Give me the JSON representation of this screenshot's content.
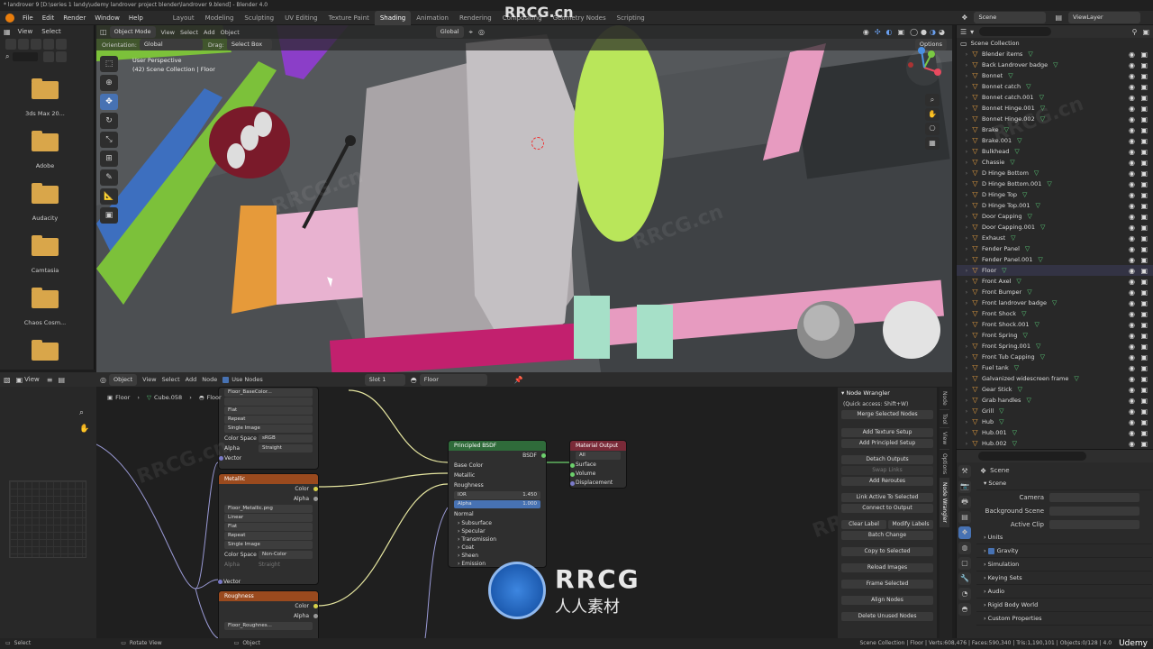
{
  "title": "* landrover 9 [D:\\series 1 landy\\udemy landrover project blender\\landrover 9.blend] - Blender 4.0",
  "menu": [
    "File",
    "Edit",
    "Render",
    "Window",
    "Help"
  ],
  "workspaces": [
    "Layout",
    "Modeling",
    "Sculpting",
    "UV Editing",
    "Texture Paint",
    "Shading",
    "Animation",
    "Rendering",
    "Compositing",
    "Geometry Nodes",
    "Scripting"
  ],
  "active_workspace": "Shading",
  "scene_label": "Scene",
  "view_layer_label": "ViewLayer",
  "watermark_text": "RRCG.cn",
  "filebrowser": {
    "menu": [
      "View",
      "Select"
    ],
    "folders": [
      "3ds Max 20...",
      "Adobe",
      "Audacity",
      "Camtasia",
      "Chaos Cosm..."
    ]
  },
  "viewport": {
    "mode": "Object Mode",
    "menu": [
      "View",
      "Select",
      "Add",
      "Object"
    ],
    "transform": "Global",
    "orientation_label": "Orientation:",
    "orientation_value": "Global",
    "drag_label": "Drag:",
    "drag_value": "Select Box",
    "options": "Options",
    "overlay_line1": "User Perspective",
    "overlay_line2": "(42) Scene Collection | Floor"
  },
  "outliner": {
    "root": "Scene Collection",
    "items": [
      "Blender items",
      "Back Landrover badge",
      "Bonnet",
      "Bonnet catch",
      "Bonnet catch.001",
      "Bonnet Hinge.001",
      "Bonnet Hinge.002",
      "Brake",
      "Brake.001",
      "Bulkhead",
      "Chassie",
      "D Hinge Bottom",
      "D Hinge Bottom.001",
      "D Hinge Top",
      "D Hinge Top.001",
      "Door Capping",
      "Door Capping.001",
      "Exhaust",
      "Fender Panel",
      "Fender Panel.001",
      "Floor",
      "Front Axel",
      "Front Bumper",
      "Front landrover badge",
      "Front Shock",
      "Front Shock.001",
      "Front Spring",
      "Front Spring.001",
      "Front Tub Capping",
      "Fuel tank",
      "Galvanized widescreen frame",
      "Gear Stick",
      "Grab handles",
      "Grill",
      "Hub",
      "Hub.001",
      "Hub.002"
    ]
  },
  "properties": {
    "scene_name": "Scene",
    "section_scene": "Scene",
    "camera_label": "Camera",
    "background_label": "Background Scene",
    "active_clip_label": "Active Clip",
    "sections": [
      "Units",
      "Gravity",
      "Simulation",
      "Keying Sets",
      "Audio",
      "Rigid Body World",
      "Custom Properties"
    ]
  },
  "node_editor": {
    "object_menu": "Object",
    "menu": [
      "View",
      "Select",
      "Add",
      "Node"
    ],
    "use_nodes": "Use Nodes",
    "slot": "Slot 1",
    "material": "Floor",
    "breadcrumb": [
      "Floor",
      "Cube.058",
      "Floor"
    ],
    "base_color_node": {
      "title": "Floor_BaseColor...",
      "interp": "Flat",
      "ext": "Repeat",
      "src": "Single Image",
      "cs_label": "Color Space",
      "cs": "sRGB",
      "alpha_label": "Alpha",
      "alpha": "Straight",
      "vector": "Vector"
    },
    "metallic_node": {
      "title": "Metallic",
      "color": "Color",
      "alpha": "Alpha",
      "file": "Floor_Metallic.png",
      "interp": "Linear",
      "proj": "Flat",
      "ext": "Repeat",
      "src": "Single Image",
      "cs_label": "Color Space",
      "cs": "Non-Color",
      "alpha_label": "Alpha",
      "alpha_val": "Straight",
      "vector": "Vector"
    },
    "roughness_node": {
      "title": "Roughness",
      "color": "Color",
      "alpha": "Alpha",
      "file": "Floor_Roughnes..."
    },
    "bsdf": {
      "title": "Principled BSDF",
      "out": "BSDF",
      "rows": [
        "Base Color",
        "Metallic",
        "Roughness"
      ],
      "ior_label": "IOR",
      "ior": "1.450",
      "alpha_label": "Alpha",
      "alpha": "1.000",
      "normal": "Normal",
      "panels": [
        "Subsurface",
        "Specular",
        "Transmission",
        "Coat",
        "Sheen",
        "Emission"
      ]
    },
    "output": {
      "title": "Material Output",
      "target": "All",
      "rows": [
        "Surface",
        "Volume",
        "Displacement"
      ]
    }
  },
  "node_wrangler": {
    "title": "Node Wrangler",
    "quick": "(Quick access: Shift+W)",
    "merge": "Merge Selected Nodes",
    "buttons1": [
      "Add Texture Setup",
      "Add Principled Setup"
    ],
    "buttons2": [
      "Detach Outputs",
      "Swap Links"
    ],
    "reroutes": "Add Reroutes",
    "buttons3": [
      "Link Active To Selected",
      "Connect to Output"
    ],
    "labels": [
      "Clear Label",
      "Modify Labels"
    ],
    "batch": "Batch Change",
    "copy": "Copy to Selected",
    "buttons4": [
      "Reload Images",
      "Frame Selected",
      "Align Nodes",
      "Delete Unused Nodes"
    ],
    "tabs": [
      "Node",
      "Tool",
      "View",
      "Options",
      "Node Wrangler"
    ]
  },
  "statusbar": {
    "left": "Select",
    "mid1": "Rotate View",
    "mid2": "Object",
    "right": "Scene Collection | Floor | Verts:608,476 | Faces:590,340 | Tris:1,190,101 | Objects:0/128 | 4.0"
  },
  "brand": {
    "logo_text": "RRCG",
    "logo_sub": "人人素材",
    "udemy": "Udemy"
  }
}
